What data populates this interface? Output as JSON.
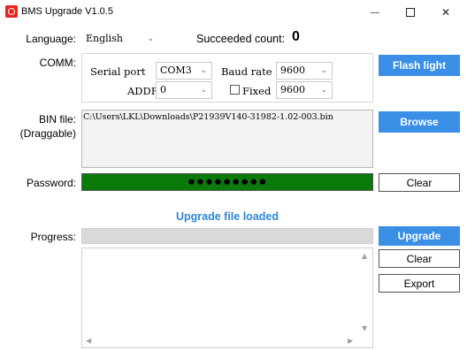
{
  "window": {
    "title": "BMS Upgrade V1.0.5",
    "minimize_glyph": "—",
    "close_glyph": "✕"
  },
  "language": {
    "label": "Language:",
    "selected": "English"
  },
  "succeeded": {
    "label": "Succeeded count:",
    "count": "0"
  },
  "comm": {
    "label": "COMM:",
    "serial_port_label": "Serial port",
    "serial_port_value": "COM3",
    "baud_rate_label": "Baud rate",
    "baud_rate_value": "9600",
    "addr_label": "ADDR",
    "addr_value": "0",
    "fixed_label": "Fixed",
    "fixed_checked": false,
    "fixed_value": "9600"
  },
  "bin_file": {
    "label_line1": "BIN file:",
    "label_line2": "(Draggable)",
    "path": "C:\\Users\\LKL\\Downloads\\P21939V140-31982-1.02-003.bin"
  },
  "password": {
    "label": "Password:",
    "masked": "●●●●●●●●●",
    "bar_color": "#0a7a0a"
  },
  "status": {
    "text": "Upgrade file loaded",
    "color": "#2f86d8"
  },
  "progress": {
    "label": "Progress:",
    "value_percent": 0
  },
  "buttons": {
    "flash_light": "Flash light",
    "browse": "Browse",
    "clear_password": "Clear",
    "upgrade": "Upgrade",
    "clear_log": "Clear",
    "export": "Export"
  },
  "colors": {
    "accent": "#3a8ee6",
    "close_icon_red": "#e8251f"
  }
}
